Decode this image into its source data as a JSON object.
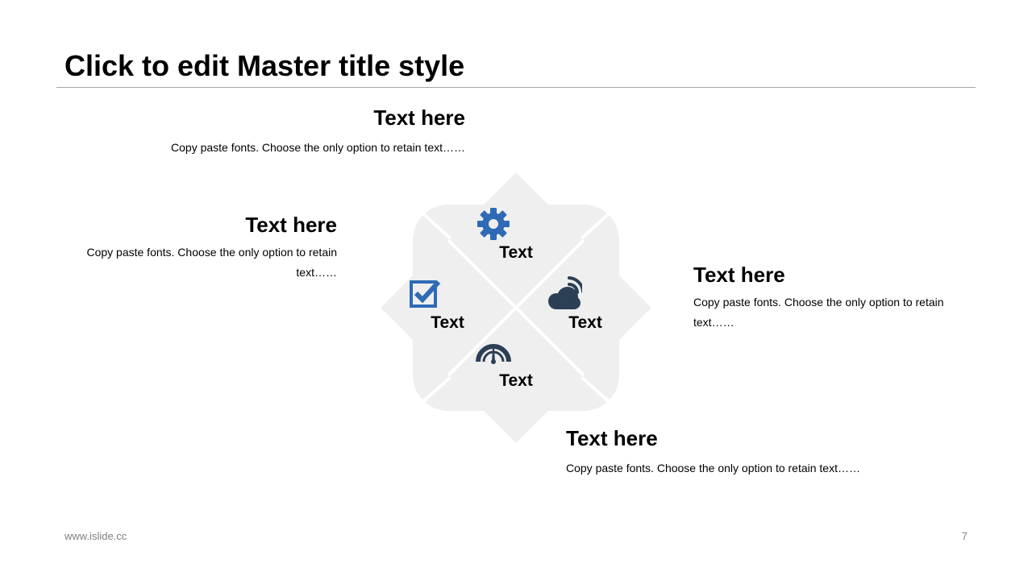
{
  "slide": {
    "title": "Click to edit Master title style"
  },
  "blocks": [
    {
      "heading": "Text here",
      "body": "Copy paste fonts. Choose the only option to retain text……"
    },
    {
      "heading": "Text here",
      "body": "Copy paste fonts. Choose the only option to retain text……"
    },
    {
      "heading": "Text here",
      "body": "Copy paste fonts. Choose the only option to retain text……"
    },
    {
      "heading": "Text here",
      "body": "Copy paste fonts. Choose the only option to retain text……"
    }
  ],
  "diagram": {
    "cells": [
      {
        "label": "Text",
        "icon": "gear-icon"
      },
      {
        "label": "Text",
        "icon": "checkbox-icon"
      },
      {
        "label": "Text",
        "icon": "cloud-signal-icon"
      },
      {
        "label": "Text",
        "icon": "speedometer-icon"
      }
    ],
    "colors": {
      "background": "#efefef",
      "icon_blue": "#2f6bb5",
      "icon_dark": "#2b3f55"
    }
  },
  "footer": {
    "website": "www.islide.cc",
    "page_number": "7"
  }
}
